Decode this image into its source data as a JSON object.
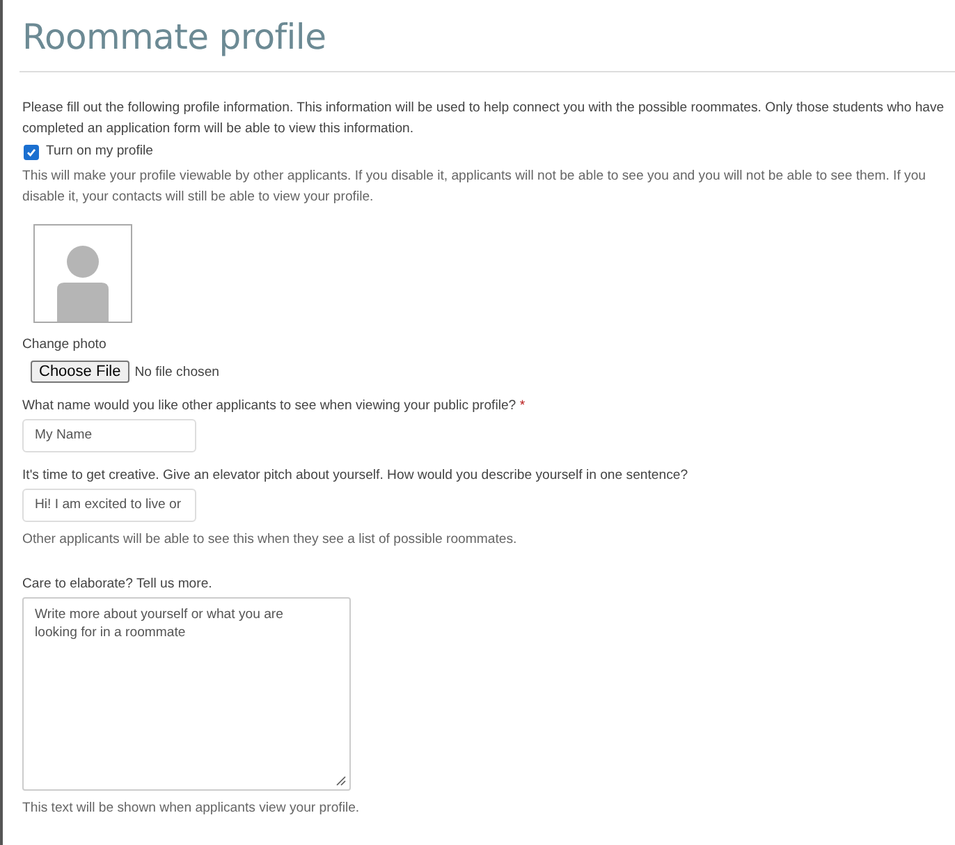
{
  "page": {
    "title": "Roommate profile"
  },
  "intro": "Please fill out the following profile information. This information will be used to help connect you with the possible roommates. Only those students who have completed an application form will be able to view this information.",
  "profile_toggle": {
    "label": "Turn on my profile",
    "checked": true
  },
  "toggle_help": "This will make your profile viewable by other applicants. If you disable it, applicants will not be able to see you and you will not be able to see them. If you disable it, your contacts will still be able to view your profile.",
  "photo": {
    "label": "Change photo",
    "button": "Choose File",
    "status": "No file chosen"
  },
  "fields": [
    {
      "kind": "input",
      "label": "What name would you like other applicants to see when viewing your public profile?",
      "required": true,
      "required_mark": "*",
      "value": "My Name"
    },
    {
      "kind": "input",
      "label": "It's time to get creative. Give an elevator pitch about yourself. How would you describe yourself in one sentence?",
      "value": "Hi! I am excited to live or",
      "help": "Other applicants will be able to see this when they see a list of possible roommates."
    },
    {
      "kind": "textarea",
      "label": "Care to elaborate? Tell us more.",
      "placeholder": "Write more about yourself or what you are looking for in a roommate",
      "help": "This text will be shown when applicants view your profile."
    }
  ]
}
